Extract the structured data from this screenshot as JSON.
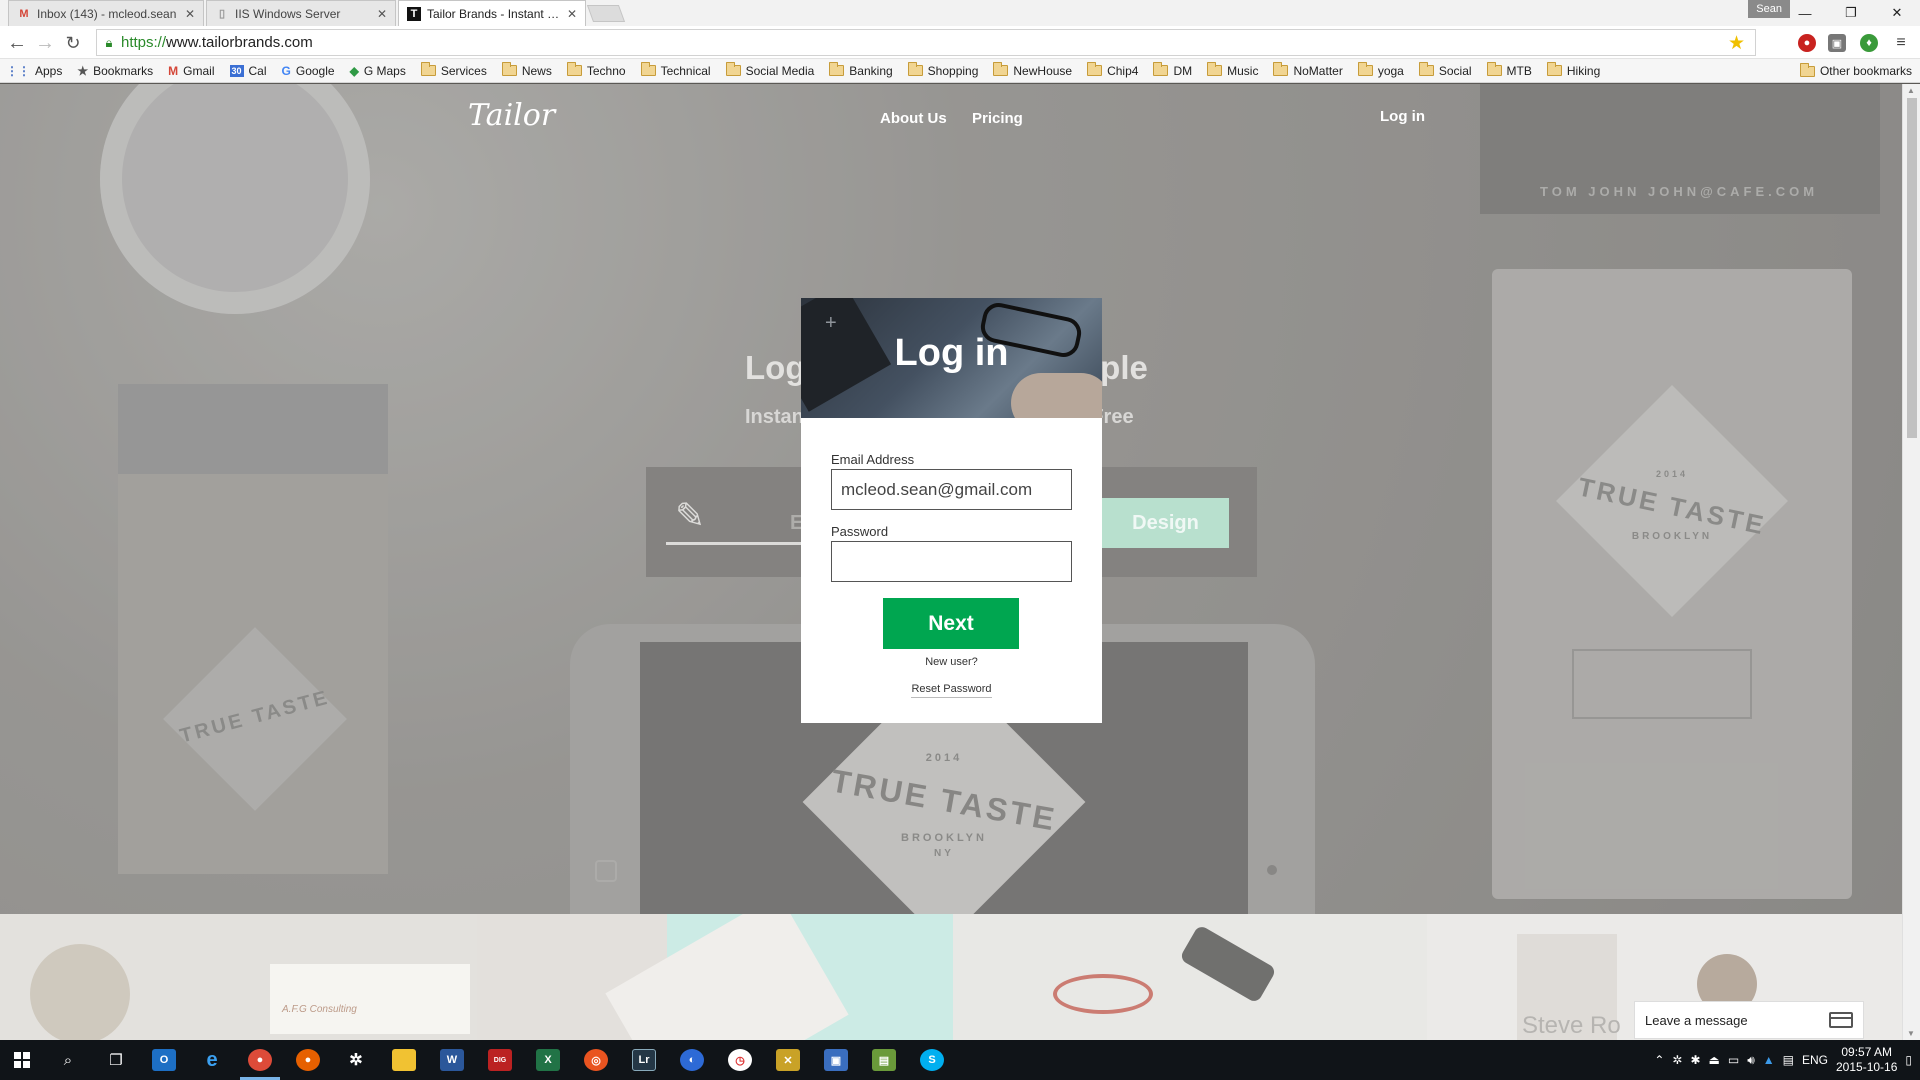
{
  "browser": {
    "tabs": [
      {
        "title": "Inbox (143) - mcleod.sean",
        "icon": "gmail-icon"
      },
      {
        "title": "IIS Windows Server",
        "icon": "page-icon"
      },
      {
        "title": "Tailor Brands - Instant Log",
        "icon": "tailor-icon"
      }
    ],
    "user": "Sean",
    "url_scheme": "https://",
    "url_rest": "www.tailorbrands.com",
    "bookmarks": [
      {
        "label": "Apps",
        "icon": "apps-grid-icon"
      },
      {
        "label": "Bookmarks",
        "icon": "star-icon"
      },
      {
        "label": "Gmail",
        "icon": "gmail-icon"
      },
      {
        "label": "Cal",
        "icon": "calendar-icon"
      },
      {
        "label": "Google",
        "icon": "google-icon"
      },
      {
        "label": "G Maps",
        "icon": "maps-icon"
      },
      {
        "label": "Services",
        "icon": "folder-icon"
      },
      {
        "label": "News",
        "icon": "folder-icon"
      },
      {
        "label": "Techno",
        "icon": "folder-icon"
      },
      {
        "label": "Technical",
        "icon": "folder-icon"
      },
      {
        "label": "Social Media",
        "icon": "folder-icon"
      },
      {
        "label": "Banking",
        "icon": "folder-icon"
      },
      {
        "label": "Shopping",
        "icon": "folder-icon"
      },
      {
        "label": "NewHouse",
        "icon": "folder-icon"
      },
      {
        "label": "Chip4",
        "icon": "folder-icon"
      },
      {
        "label": "DM",
        "icon": "folder-icon"
      },
      {
        "label": "Music",
        "icon": "folder-icon"
      },
      {
        "label": "NoMatter",
        "icon": "folder-icon"
      },
      {
        "label": "yoga",
        "icon": "folder-icon"
      },
      {
        "label": "Social",
        "icon": "folder-icon"
      },
      {
        "label": "MTB",
        "icon": "folder-icon"
      },
      {
        "label": "Hiking",
        "icon": "folder-icon"
      }
    ],
    "other_bookmarks": "Other bookmarks",
    "calendar_day": "30"
  },
  "site": {
    "logo": "Tailor",
    "nav": {
      "about": "About Us",
      "pricing": "Pricing",
      "login": "Log in"
    },
    "hero": {
      "title_left": "Log",
      "title_right": "nple",
      "subtitle_left": "Instan",
      "subtitle_right": "r Free",
      "input_letter": "E",
      "design_button": "Design"
    },
    "props": {
      "card_text": "TOM JOHN JOHN@CAFE.COM",
      "brand_name": "TRUE TASTE",
      "brand_city": "BROOKLYN",
      "brand_state": "NY",
      "brand_year": "2014",
      "tagline_card": "A.F.G Consulting",
      "watermark": "Steve Ro"
    }
  },
  "modal": {
    "title": "Log in",
    "email_label": "Email Address",
    "email_value": "mcleod.sean@gmail.com",
    "password_label": "Password",
    "password_value": "",
    "next_button": "Next",
    "new_user": "New user?",
    "reset_password": "Reset Password"
  },
  "chat": {
    "label": "Leave a message"
  },
  "taskbar": {
    "clock_time": "09:57 AM",
    "clock_date": "2015-10-16",
    "language": "ENG"
  },
  "colors": {
    "accent_green": "#00a650",
    "design_button": "#9dd4bc",
    "taskbar": "#101418"
  }
}
